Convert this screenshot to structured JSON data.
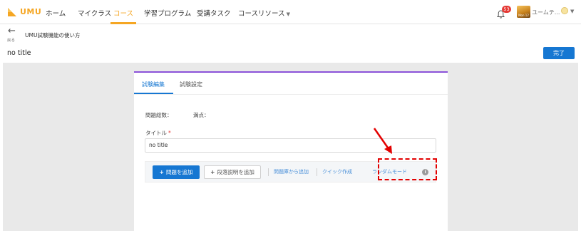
{
  "app": {
    "logo_text": "UMU"
  },
  "nav": {
    "items": [
      {
        "label": "ホーム"
      },
      {
        "label": "マイクラス"
      },
      {
        "label": "コース"
      },
      {
        "label": "学習プログラム"
      },
      {
        "label": "受講タスク"
      },
      {
        "label": "コースリソース"
      }
    ],
    "active_index": 2,
    "notification_count": "53",
    "avatar_text": "Mon 12",
    "user_name": "ユームテ..."
  },
  "header": {
    "back_label": "戻る",
    "course_title": "UMU試験機能の使い方",
    "page_title": "no title",
    "done_label": "完了"
  },
  "editor": {
    "tabs": [
      {
        "label": "試験編集"
      },
      {
        "label": "試験設定"
      }
    ],
    "active_tab": 0,
    "total_questions_label": "問題総数：",
    "full_score_label": "満点：",
    "title_label": "タイトル",
    "required_mark": "*",
    "title_value": "no title",
    "actions": {
      "add_question": "問題を追加",
      "add_section": "段落説明を追加",
      "from_bank": "問題庫から追加",
      "quick_create": "クイック作成",
      "random_mode": "ランダムモード"
    }
  },
  "colors": {
    "accent": "#f5a623",
    "primary": "#1677d2",
    "card_top": "#8b52d9",
    "annotation": "#e30000",
    "canvas": "#e9e9e9"
  }
}
